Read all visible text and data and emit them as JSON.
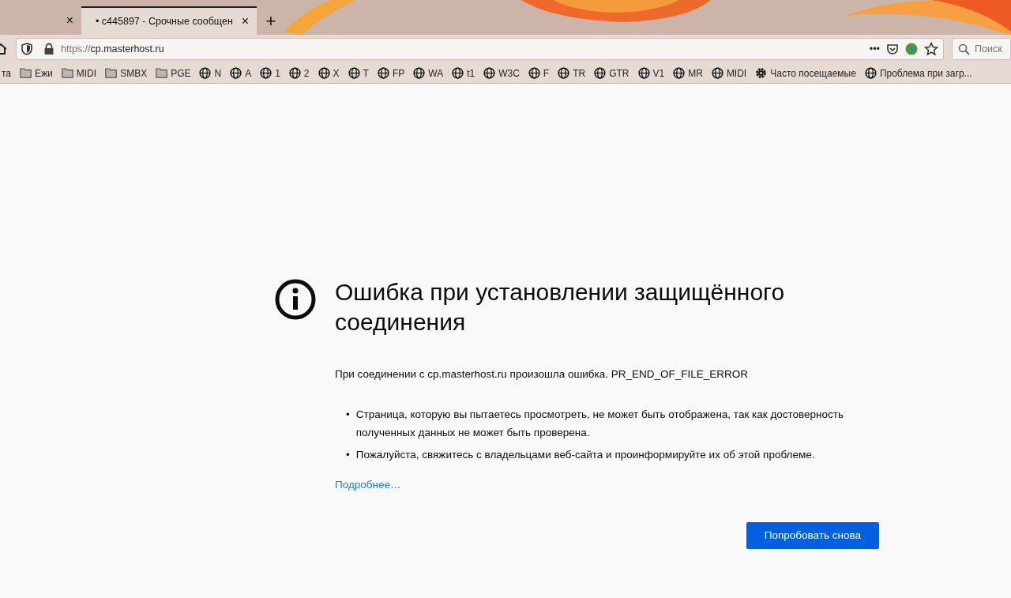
{
  "tabs": [
    {
      "selected": false,
      "close": "×"
    },
    {
      "title": "c445897 - Срочные сообщен",
      "selected": true,
      "close": "×",
      "dot": "•"
    }
  ],
  "new_tab": "+",
  "address_bar": {
    "scheme": "https://",
    "host": "cp.masterhost.ru",
    "secure": true,
    "actions": "•••"
  },
  "search": {
    "placeholder": "Поиск"
  },
  "bookmarks": [
    {
      "kind": "text",
      "label": "та"
    },
    {
      "kind": "folder",
      "label": "Ежи"
    },
    {
      "kind": "folder",
      "label": "MIDI"
    },
    {
      "kind": "folder",
      "label": "SMBX"
    },
    {
      "kind": "folder",
      "label": "PGE"
    },
    {
      "kind": "site",
      "label": "N"
    },
    {
      "kind": "site",
      "label": "A"
    },
    {
      "kind": "site",
      "label": "1"
    },
    {
      "kind": "site",
      "label": "2"
    },
    {
      "kind": "site",
      "label": "X"
    },
    {
      "kind": "site",
      "label": "T"
    },
    {
      "kind": "site",
      "label": "FP"
    },
    {
      "kind": "site",
      "label": "WA"
    },
    {
      "kind": "site",
      "label": "t1"
    },
    {
      "kind": "site",
      "label": "W3C"
    },
    {
      "kind": "site",
      "label": "F"
    },
    {
      "kind": "site",
      "label": "TR"
    },
    {
      "kind": "site",
      "label": "GTR"
    },
    {
      "kind": "site",
      "label": "V1"
    },
    {
      "kind": "site",
      "label": "MR"
    },
    {
      "kind": "site",
      "label": "MIDI"
    },
    {
      "kind": "settings",
      "label": "Часто посещаемые"
    },
    {
      "kind": "site",
      "label": "Проблема при загр..."
    }
  ],
  "error": {
    "title": "Ошибка при установлении защищённого соединения",
    "message": "При соединении с cp.masterhost.ru произошла ошибка. PR_END_OF_FILE_ERROR",
    "bullets": [
      {
        "marker": "•",
        "text": "Страница, которую вы пытаетесь просмотреть, не может быть отображена, так как достоверность полученных данных не может быть проверена."
      },
      {
        "marker": "•",
        "text": "Пожалуйста, свяжитесь с владельцами веб-сайта и проинформируйте их об этой проблеме."
      }
    ],
    "link": "Подробнее…",
    "button": "Попробовать снова"
  }
}
